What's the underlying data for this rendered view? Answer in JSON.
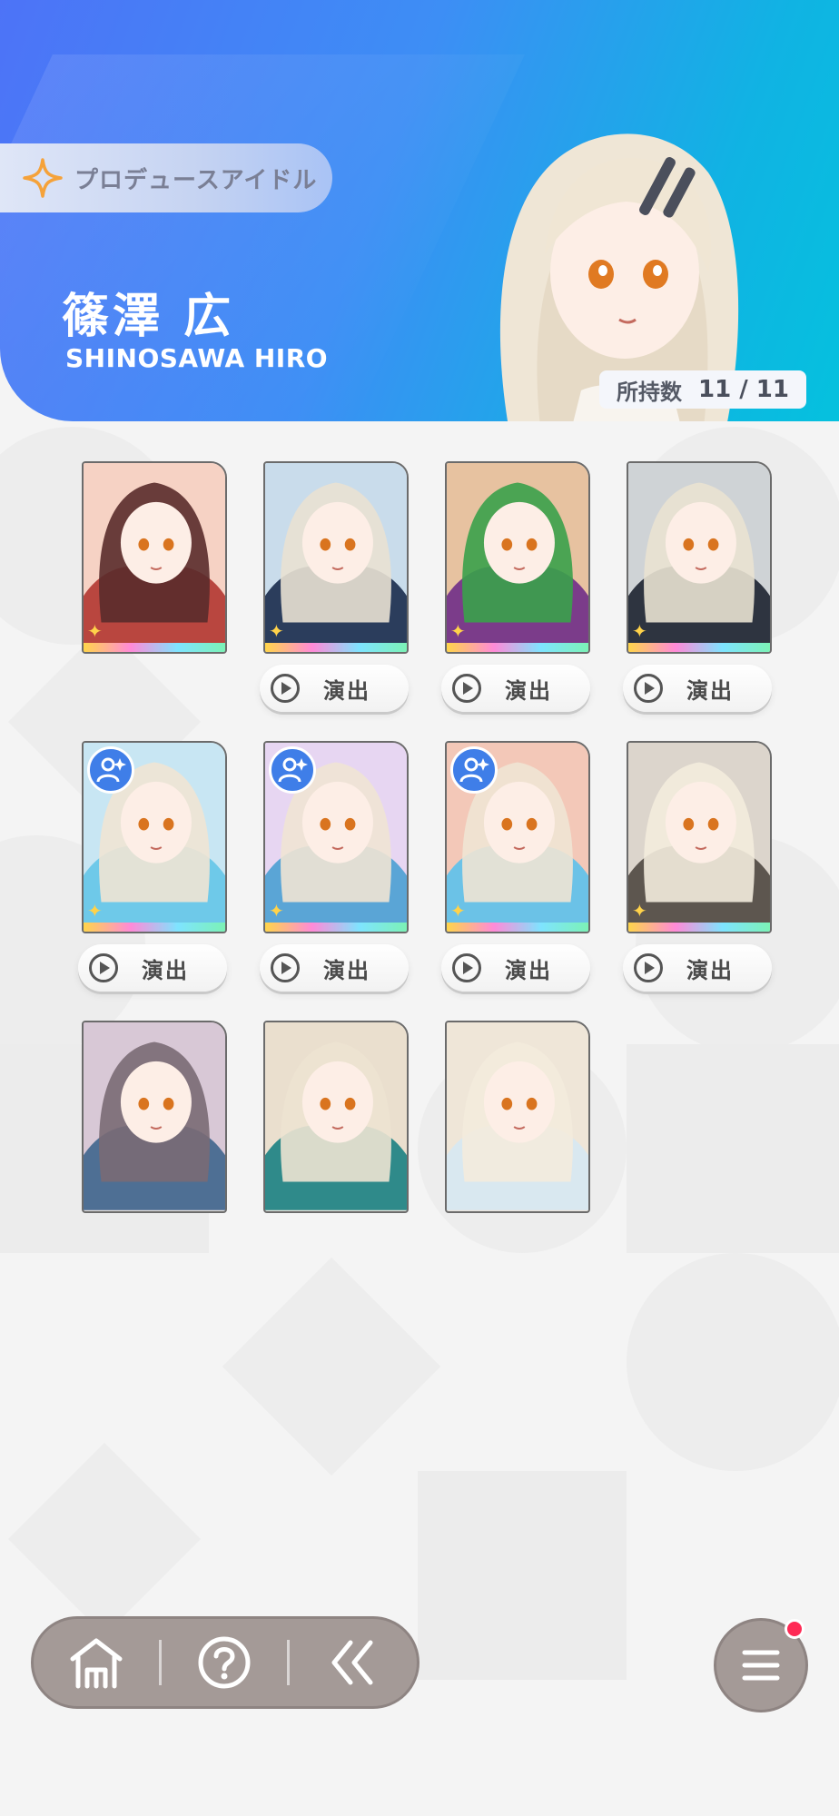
{
  "header": {
    "category_label": "プロデュースアイドル",
    "name_jp": "篠澤 広",
    "name_en": "SHINOSAWA HIRO",
    "owned_label": "所持数",
    "owned_value": "11 / 11"
  },
  "cards": [
    {
      "id": "card-1",
      "play_button": false,
      "support_badge": false
    },
    {
      "id": "card-2",
      "play_button": true,
      "support_badge": false
    },
    {
      "id": "card-3",
      "play_button": true,
      "support_badge": false
    },
    {
      "id": "card-4",
      "play_button": true,
      "support_badge": false
    },
    {
      "id": "card-5",
      "play_button": true,
      "support_badge": true
    },
    {
      "id": "card-6",
      "play_button": true,
      "support_badge": true
    },
    {
      "id": "card-7",
      "play_button": true,
      "support_badge": true
    },
    {
      "id": "card-8",
      "play_button": true,
      "support_badge": false
    },
    {
      "id": "card-9",
      "play_button": false,
      "support_badge": false
    },
    {
      "id": "card-10",
      "play_button": false,
      "support_badge": false
    },
    {
      "id": "card-11",
      "play_button": false,
      "support_badge": false
    }
  ],
  "play_label": "演出",
  "nav": {
    "icons": [
      "home-icon",
      "help-icon",
      "back-icon"
    ],
    "menu_icon": "menu-icon",
    "notification": true
  },
  "colors": {
    "header_start": "#4d73f7",
    "header_end": "#05c1de",
    "nav_bg": "#a49a97",
    "notification_dot": "#ff2a55"
  }
}
